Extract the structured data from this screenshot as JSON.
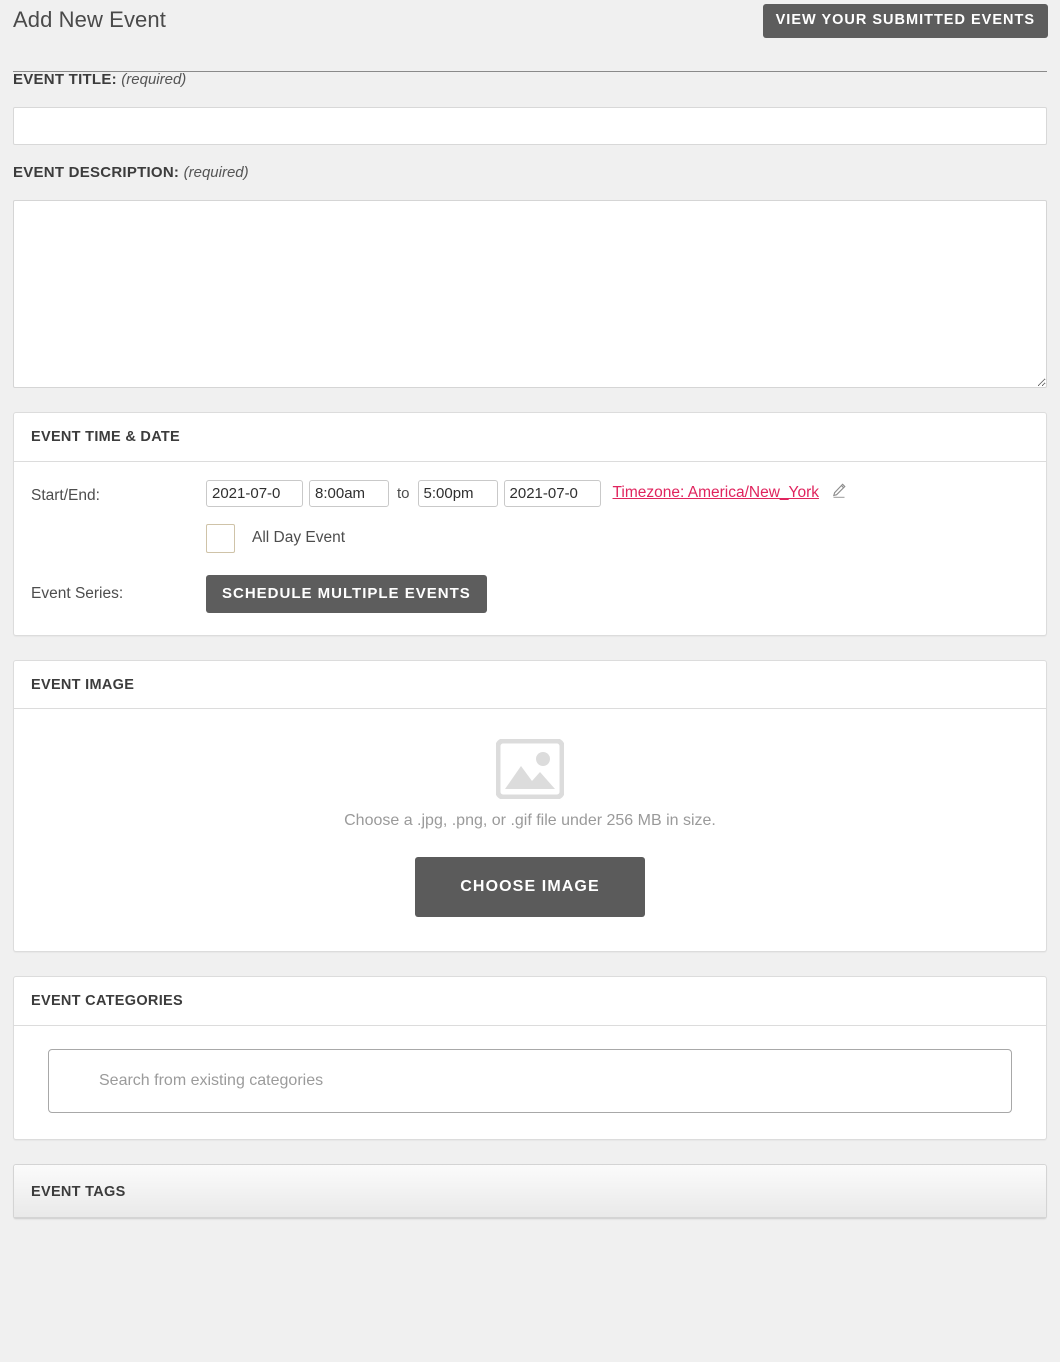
{
  "header": {
    "title": "Add New Event",
    "view_events_label": "VIEW YOUR SUBMITTED EVENTS"
  },
  "fields": {
    "title": {
      "label": "EVENT TITLE:",
      "required_note": "(required)",
      "value": "",
      "placeholder": ""
    },
    "description": {
      "label": "EVENT DESCRIPTION:",
      "required_note": "(required)",
      "value": "",
      "placeholder": ""
    }
  },
  "time_date": {
    "panel_title": "EVENT TIME & DATE",
    "start_end_label": "Start/End:",
    "start_date": "2021-07-0",
    "start_time": "8:00am",
    "to_word": "to",
    "end_time": "5:00pm",
    "end_date": "2021-07-0",
    "timezone_link": "Timezone: America/New_York",
    "timezone_color": "#e0245e",
    "edit_icon": "pencil-icon",
    "all_day_label": "All Day Event",
    "all_day_checked": false,
    "event_series_label": "Event Series:",
    "schedule_multiple_label": "SCHEDULE MULTIPLE EVENTS"
  },
  "image": {
    "panel_title": "EVENT IMAGE",
    "placeholder_icon": "image-placeholder-icon",
    "hint": "Choose a .jpg, .png, or .gif file under 256 MB in size.",
    "choose_label": "CHOOSE IMAGE"
  },
  "categories": {
    "panel_title": "EVENT CATEGORIES",
    "search_placeholder": "Search from existing categories",
    "search_value": ""
  },
  "tags": {
    "panel_title": "EVENT TAGS"
  },
  "colors": {
    "page_background": "#f0f0f0",
    "panel_background": "#ffffff",
    "button_dark": "#5d5d5d",
    "text_primary": "#3c3c3c",
    "text_muted": "#9a9a9a",
    "accent_link": "#e0245e"
  }
}
